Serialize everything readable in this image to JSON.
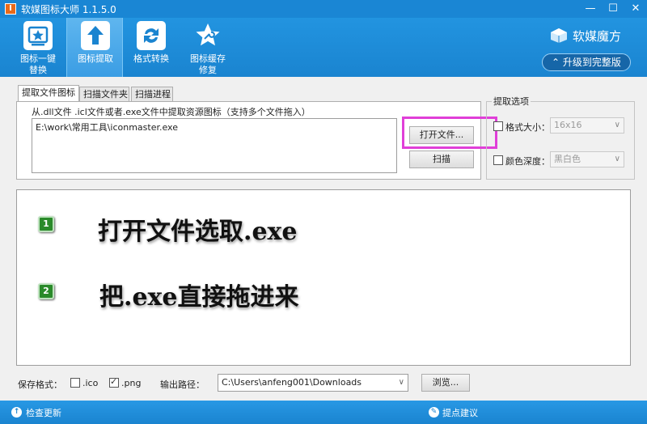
{
  "window": {
    "title": "软媒图标大师 1.1.5.0",
    "logo_char": "I"
  },
  "toolbar": {
    "items": [
      {
        "label_line1": "图标一键",
        "label_line2": "替换"
      },
      {
        "label_line1": "图标提取",
        "label_line2": ""
      },
      {
        "label_line1": "格式转换",
        "label_line2": ""
      },
      {
        "label_line1": "图标缓存",
        "label_line2": "修复"
      }
    ],
    "brand": "软媒魔方",
    "upgrade": "升级到完整版"
  },
  "tabs": [
    "提取文件图标",
    "扫描文件夹",
    "扫描进程"
  ],
  "extract": {
    "hint": "从.dll文件 .icl文件或者.exe文件中提取资源图标（支持多个文件拖入）",
    "files": [
      "E:\\work\\常用工具\\iconmaster.exe"
    ],
    "open_button": "打开文件...",
    "scan_button": "扫描"
  },
  "options": {
    "title": "提取选项",
    "format_label": "格式大小：",
    "format_value": "16x16",
    "depth_label": "颜色深度：",
    "depth_value": "黑白色"
  },
  "steps": [
    {
      "badge": "1",
      "text": "打开文件选取.exe"
    },
    {
      "badge": "2",
      "text": "把.exe直接拖进来"
    }
  ],
  "save": {
    "format_label": "保存格式：",
    "ico_label": ".ico",
    "ico_checked": false,
    "png_label": ".png",
    "png_checked": true,
    "output_label": "输出路径：",
    "output_path": "C:\\Users\\anfeng001\\Downloads",
    "browse_button": "浏览..."
  },
  "status": {
    "check_update": "检查更新",
    "suggest": "提点建议"
  },
  "colors": {
    "brand_blue": "#1a86d4",
    "highlight": "#e03fd8",
    "badge_green": "#2a8a2a"
  }
}
